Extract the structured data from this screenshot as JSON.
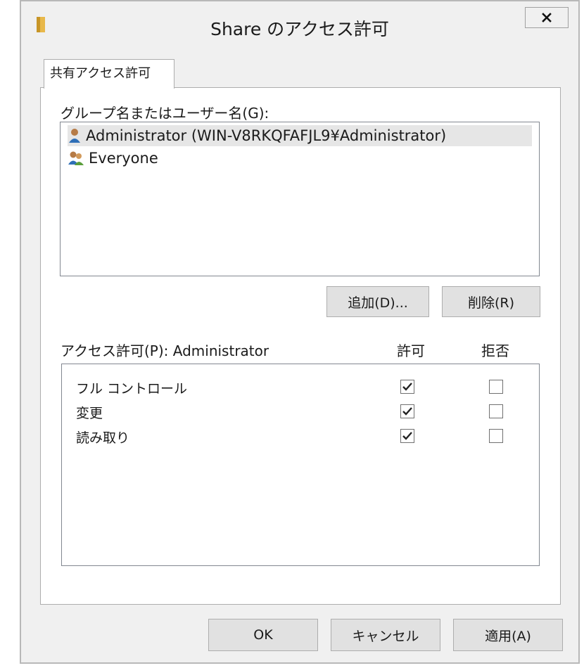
{
  "window": {
    "title": "Share のアクセス許可",
    "close_label": "x"
  },
  "tabs": [
    {
      "label": "共有アクセス許可"
    }
  ],
  "groups": {
    "label": "グループ名またはユーザー名(G):",
    "items": [
      {
        "name": "Administrator (WIN-V8RKQFAFJL9¥Administrator)",
        "icon": "user-icon",
        "selected": true
      },
      {
        "name": "Everyone",
        "icon": "users-group-icon",
        "selected": false
      }
    ]
  },
  "buttons": {
    "add": "追加(D)...",
    "remove": "削除(R)",
    "ok": "OK",
    "cancel": "キャンセル",
    "apply": "適用(A)"
  },
  "permissions": {
    "label": "アクセス許可(P): Administrator",
    "allow_header": "許可",
    "deny_header": "拒否",
    "rows": [
      {
        "name": "フル コントロール",
        "allow": true,
        "deny": false
      },
      {
        "name": "変更",
        "allow": true,
        "deny": false
      },
      {
        "name": "読み取り",
        "allow": true,
        "deny": false
      }
    ]
  }
}
